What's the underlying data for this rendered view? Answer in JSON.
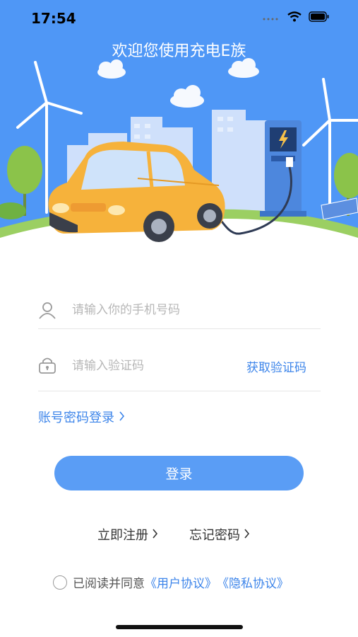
{
  "status_bar": {
    "time": "17:54"
  },
  "header": {
    "title": "欢迎您使用充电E族"
  },
  "form": {
    "phone_placeholder": "请输入你的手机号码",
    "code_placeholder": "请输入验证码",
    "get_code_label": "获取验证码",
    "password_login_label": "账号密码登录",
    "login_label": "登录"
  },
  "links": {
    "register": "立即注册",
    "forgot": "忘记密码"
  },
  "agreement": {
    "prefix": "已阅读并同意",
    "user_agreement": "《用户协议》",
    "privacy": "《隐私协议》"
  },
  "colors": {
    "primary": "#5a9df5",
    "link": "#3d85ea",
    "hero": "#4f97f6"
  }
}
